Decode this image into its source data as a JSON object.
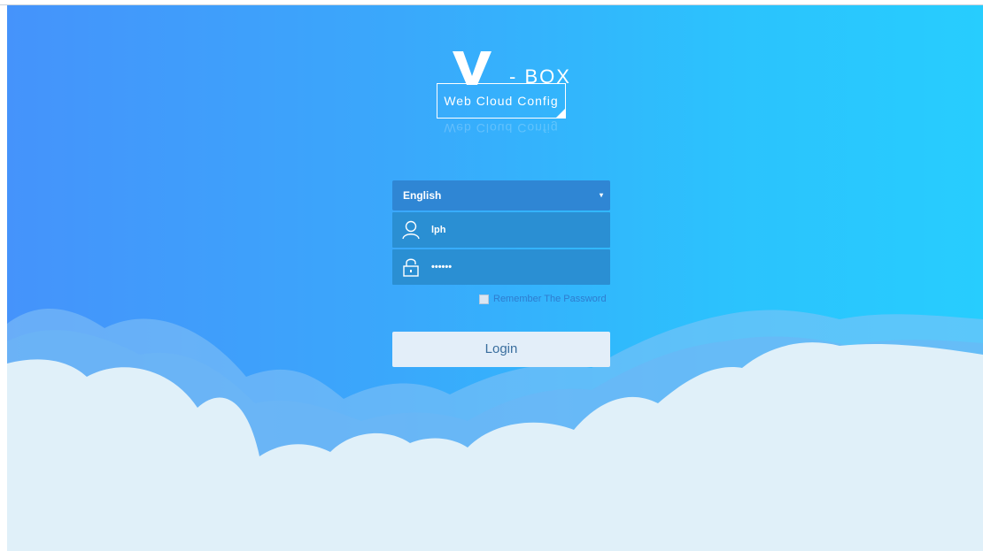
{
  "logo": {
    "letter": "V",
    "suffix": "- BOX",
    "box_text": "Web Cloud Config"
  },
  "language_select": {
    "value": "English",
    "caret": "▾"
  },
  "username": {
    "value": "lph",
    "icon": "user-icon"
  },
  "password": {
    "value": "••••••",
    "icon": "lock-icon"
  },
  "remember": {
    "label": "Remember The Password",
    "checked": false
  },
  "login_button": {
    "label": "Login"
  },
  "colors": {
    "background_start": "#4593fb",
    "background_end": "#27cdfe",
    "cloud_front": "#e0f0f9",
    "input_bg": "#2a8fd3",
    "button_bg": "#e3eef9"
  }
}
